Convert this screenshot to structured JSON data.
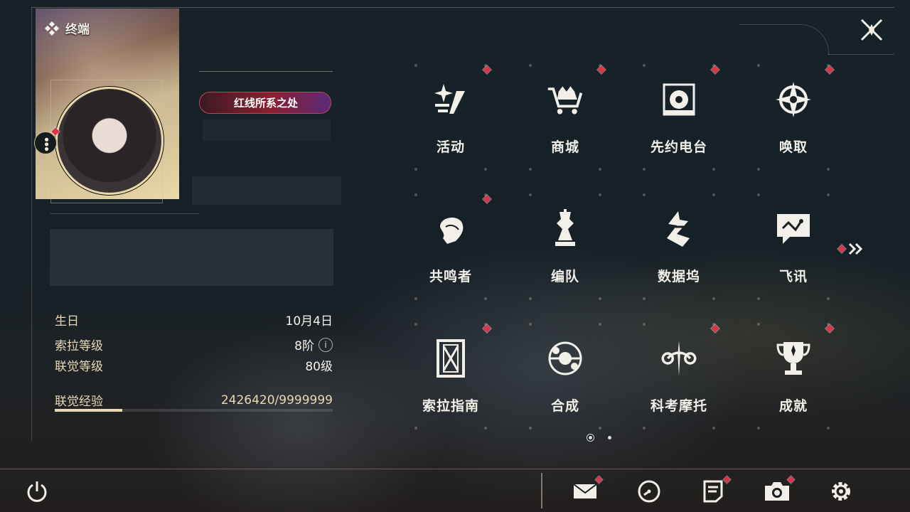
{
  "header": {
    "title": "终端"
  },
  "profile": {
    "title_badge": "红线所系之处",
    "stats": [
      {
        "label": "生日",
        "value": "10月4日"
      },
      {
        "label": "索拉等级",
        "value": "8阶"
      },
      {
        "label": "联觉等级",
        "value": "80级"
      }
    ],
    "experience": {
      "label": "联觉经验",
      "value": "2426420/9999999",
      "progress": 0.2426
    }
  },
  "menu": {
    "items": [
      {
        "label": "活动",
        "icon": "sparkle-icon",
        "badge": true
      },
      {
        "label": "商城",
        "icon": "shopping-cart-icon",
        "badge": true
      },
      {
        "label": "先约电台",
        "icon": "radio-icon",
        "badge": true
      },
      {
        "label": "唤取",
        "icon": "compass-star-icon",
        "badge": true
      },
      {
        "label": "共鸣者",
        "icon": "character-icon",
        "badge": true
      },
      {
        "label": "编队",
        "icon": "chess-piece-icon",
        "badge": false
      },
      {
        "label": "数据坞",
        "icon": "data-dock-icon",
        "badge": false
      },
      {
        "label": "飞讯",
        "icon": "message-chat-icon",
        "badge": false
      },
      {
        "label": "索拉指南",
        "icon": "guide-book-icon",
        "badge": true
      },
      {
        "label": "合成",
        "icon": "synthesis-icon",
        "badge": false
      },
      {
        "label": "科考摩托",
        "icon": "motorcycle-icon",
        "badge": true
      },
      {
        "label": "成就",
        "icon": "trophy-icon",
        "badge": true
      }
    ],
    "pages": 2,
    "current_page": 1
  },
  "bottom_bar": {
    "icons": [
      "mail-icon",
      "clock-icon",
      "notice-icon",
      "camera-icon",
      "settings-gear-icon"
    ]
  },
  "colors": {
    "accent": "#e8d8b4",
    "badge": "#d9364c",
    "background": "#162228"
  }
}
